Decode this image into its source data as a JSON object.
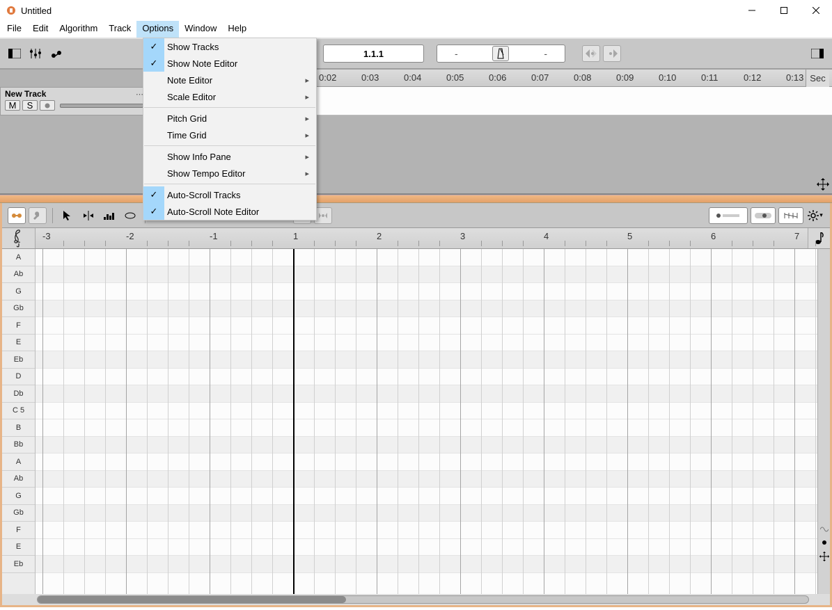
{
  "window": {
    "title": "Untitled"
  },
  "menubar": [
    "File",
    "Edit",
    "Algorithm",
    "Track",
    "Options",
    "Window",
    "Help"
  ],
  "menubar_open_index": 4,
  "options_menu": {
    "groups": [
      [
        {
          "label": "Show Tracks",
          "checked": true,
          "submenu": false
        },
        {
          "label": "Show Note Editor",
          "checked": true,
          "submenu": false
        },
        {
          "label": "Note Editor",
          "checked": false,
          "submenu": true
        },
        {
          "label": "Scale Editor",
          "checked": false,
          "submenu": true
        }
      ],
      [
        {
          "label": "Pitch Grid",
          "checked": false,
          "submenu": true
        },
        {
          "label": "Time Grid",
          "checked": false,
          "submenu": true
        }
      ],
      [
        {
          "label": "Show Info Pane",
          "checked": false,
          "submenu": true
        },
        {
          "label": "Show Tempo Editor",
          "checked": false,
          "submenu": true
        }
      ],
      [
        {
          "label": "Auto-Scroll Tracks",
          "checked": true,
          "submenu": false
        },
        {
          "label": "Auto-Scroll Note Editor",
          "checked": true,
          "submenu": false
        }
      ]
    ]
  },
  "transport": {
    "counter": "1.1.1"
  },
  "tempo": {
    "left": "-",
    "right": "-"
  },
  "time_ruler": {
    "unit": "Sec",
    "ticks": [
      "0:02",
      "0:03",
      "0:04",
      "0:05",
      "0:06",
      "0:07",
      "0:08",
      "0:09",
      "0:10",
      "0:11",
      "0:12",
      "0:13"
    ]
  },
  "track": {
    "name": "New Track",
    "mute": "M",
    "solo": "S"
  },
  "beat_ruler": {
    "labels": [
      "-3",
      "-2",
      "-1",
      "1",
      "2",
      "3",
      "4",
      "5",
      "6",
      "7"
    ]
  },
  "piano_keys": [
    "A",
    "Ab",
    "G",
    "Gb",
    "F",
    "E",
    "Eb",
    "D",
    "Db",
    "C 5",
    "B",
    "Bb",
    "A",
    "Ab",
    "G",
    "Gb",
    "F",
    "E",
    "Eb"
  ]
}
